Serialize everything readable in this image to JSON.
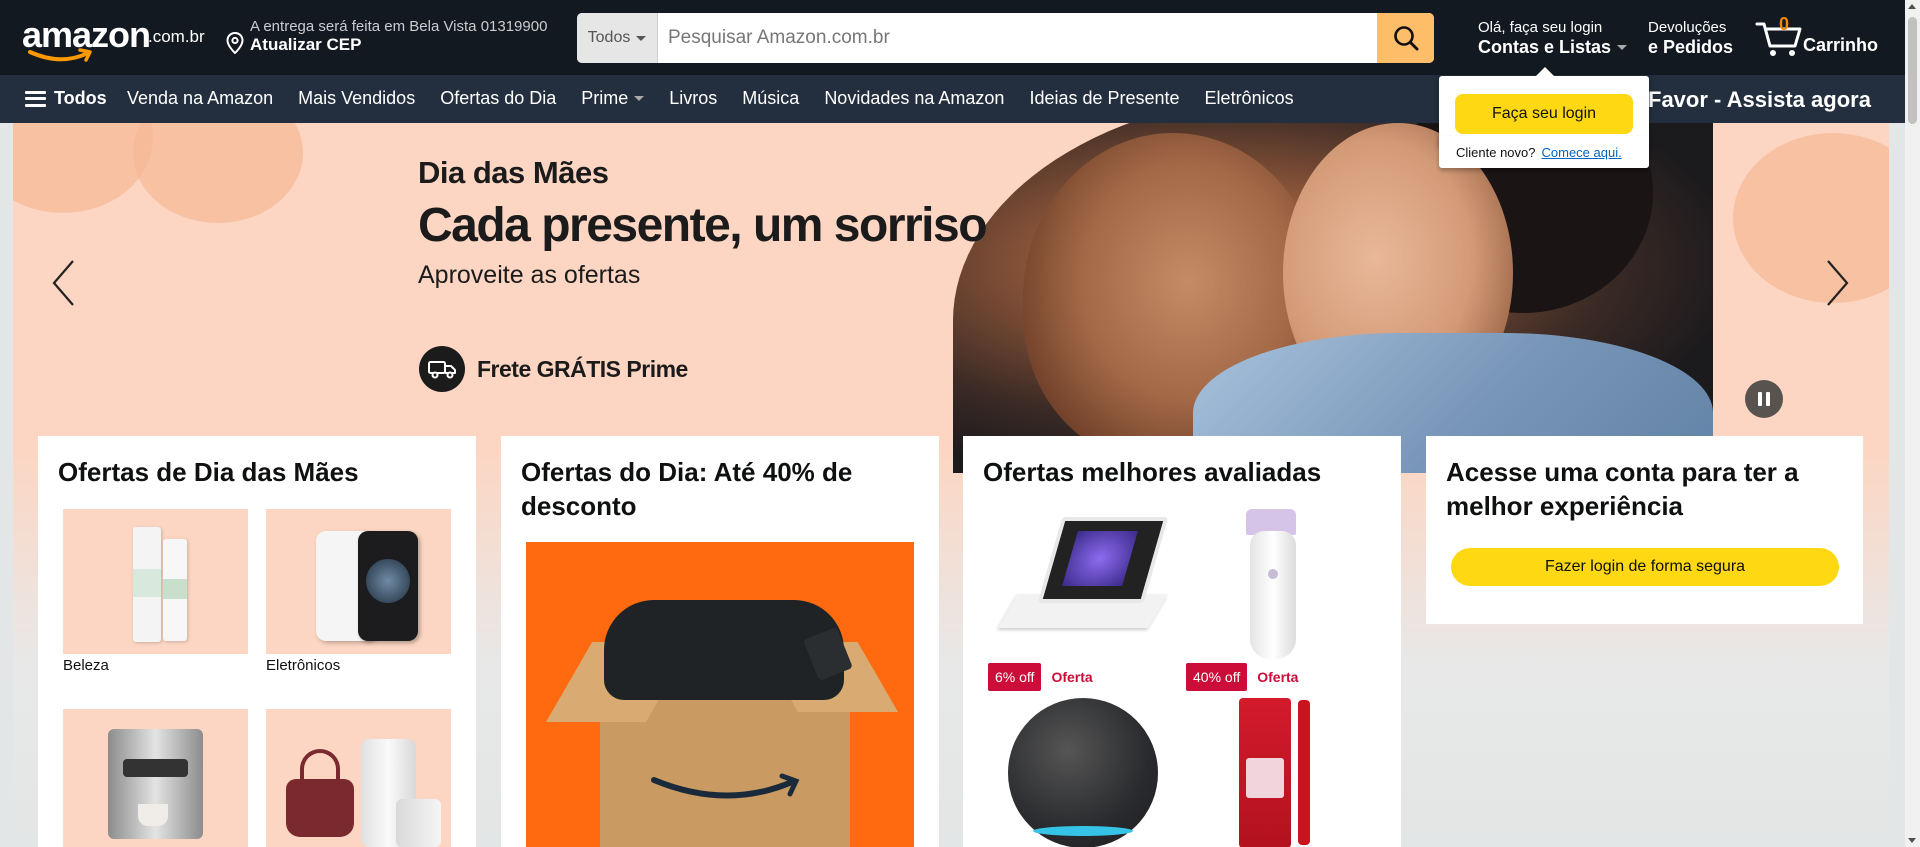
{
  "header": {
    "logo_word": "amazon",
    "logo_tld": ".com.br",
    "delivery_line1": "A entrega será feita em Bela Vista 01319900",
    "delivery_line2": "Atualizar CEP",
    "search_category": "Todos",
    "search_placeholder": "Pesquisar Amazon.com.br",
    "account_line1": "Olá, faça seu login",
    "account_line2": "Contas e Listas",
    "returns_line1": "Devoluções",
    "returns_line2": "e Pedidos",
    "cart_count": "0",
    "cart_label": "Carrinho"
  },
  "nav": {
    "all_label": "Todos",
    "items": [
      "Venda na Amazon",
      "Mais Vendidos",
      "Ofertas do Dia",
      "Prime",
      "Livros",
      "Música",
      "Novidades na Amazon",
      "Ideias de Presente",
      "Eletrônicos"
    ],
    "promo": "Favor - Assista agora"
  },
  "flyout": {
    "button": "Faça seu login",
    "new_customer": "Cliente novo?",
    "start_link": "Comece aqui."
  },
  "hero": {
    "line1": "Dia das Mães",
    "line2": "Cada presente, um sorriso",
    "line3": "Aproveite as ofertas",
    "shipping": "Frete GRÁTIS Prime"
  },
  "cards": {
    "mothers_day": {
      "title": "Ofertas de Dia das Mães",
      "tiles": [
        "Beleza",
        "Eletrônicos",
        "",
        ""
      ]
    },
    "daily_deals": {
      "title": "Ofertas do Dia: Até 40% de desconto"
    },
    "top_rated": {
      "title": "Ofertas melhores avaliadas",
      "products": [
        {
          "discount": "6% off",
          "label": "Oferta"
        },
        {
          "discount": "40% off",
          "label": "Oferta"
        }
      ]
    },
    "signin": {
      "title": "Acesse uma conta para ter a melhor experiência",
      "button": "Fazer login de forma segura"
    }
  },
  "colors": {
    "header_bg": "#131921",
    "nav_bg": "#232f3e",
    "search_button": "#febd69",
    "cta_yellow": "#ffd814",
    "deal_red": "#cc0c39",
    "hero_peach": "#fcd6c3",
    "cart_count": "#f08804"
  },
  "icons": [
    "location-pin-icon",
    "search-icon",
    "caret-down-icon",
    "cart-icon",
    "menu-icon",
    "chevron-left-icon",
    "chevron-right-icon",
    "pause-icon",
    "delivery-truck-icon"
  ]
}
